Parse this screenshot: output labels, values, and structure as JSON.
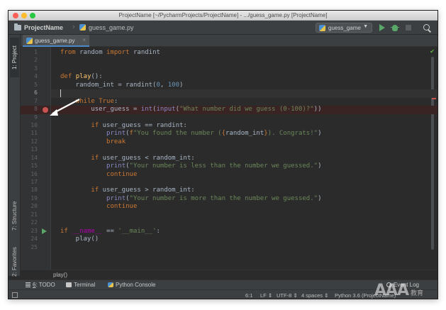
{
  "window": {
    "title": "ProjectName [~/PycharmProjects/ProjectName] - .../guess_game.py [ProjectName]"
  },
  "navbar": {
    "project": "ProjectName",
    "file": "guess_game.py",
    "run_config": "guess_game"
  },
  "left_tools": {
    "project": "1: Project",
    "structure": "7: Structure",
    "favorites": "2: Favorites"
  },
  "editor": {
    "tab": "guess_game.py",
    "breadcrumb": "play()",
    "breakpoint_line": 8,
    "caret_line": 6,
    "line_numbers": [
      "1",
      "2",
      "3",
      "4",
      "5",
      "6",
      "7",
      "8",
      "9",
      "10",
      "11",
      "12",
      "13",
      "14",
      "15",
      "16",
      "17",
      "18",
      "19",
      "20",
      "21",
      "22",
      "23",
      "24",
      "25"
    ]
  },
  "tool_windows": {
    "todo_num": "6",
    "todo": ": TODO",
    "terminal": "Terminal",
    "python_console": "Python Console",
    "event_log": "Event Log"
  },
  "status": {
    "position": "6:1",
    "line_sep": "LF",
    "encoding": "UTF-8",
    "indent": "4 spaces",
    "interpreter": "Python 3.6 (ProjectName)"
  },
  "colors": {
    "breakpoint": "#c75450",
    "run_green": "#59a869",
    "keyword": "#cc7832",
    "string": "#6a8759",
    "number": "#6897bb"
  }
}
